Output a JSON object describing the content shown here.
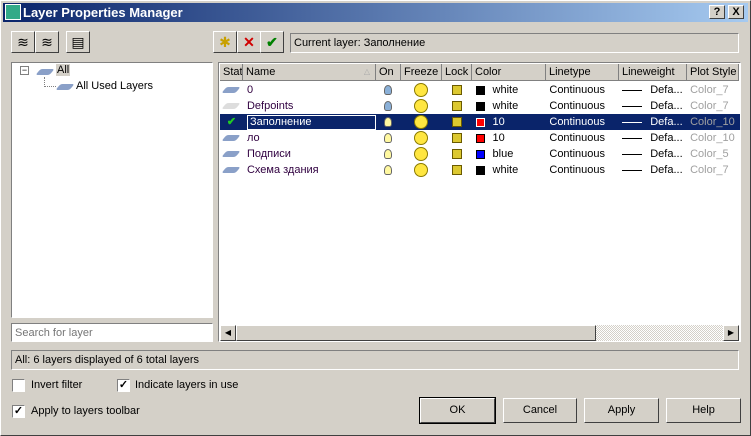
{
  "window": {
    "title": "Layer Properties Manager",
    "help": "?",
    "close": "X"
  },
  "toolbar": {
    "current_layer": "Current layer: Заполнение"
  },
  "tree": {
    "root": "All",
    "child": "All Used Layers",
    "expander": "−"
  },
  "search": {
    "placeholder": "Search for layer"
  },
  "columns": [
    "Stat",
    "Name",
    "On",
    "Freeze",
    "Lock",
    "Color",
    "Linetype",
    "Lineweight",
    "Plot Style"
  ],
  "layers": [
    {
      "name": "0",
      "color_name": "white",
      "color_hex": "#000000",
      "on": true,
      "linetype": "Continuous",
      "lineweight": "Defa...",
      "plot_style": "Color_7"
    },
    {
      "name": "Defpoints",
      "color_name": "white",
      "color_hex": "#000000",
      "on": true,
      "linetype": "Continuous",
      "lineweight": "Defa...",
      "plot_style": "Color_7"
    },
    {
      "name": "Заполнение",
      "color_name": "10",
      "color_hex": "#ff0000",
      "on": true,
      "current": true,
      "linetype": "Continuous",
      "lineweight": "Defa...",
      "plot_style": "Color_10"
    },
    {
      "name": "ло",
      "color_name": "10",
      "color_hex": "#ff0000",
      "on": true,
      "linetype": "Continuous",
      "lineweight": "Defa...",
      "plot_style": "Color_10"
    },
    {
      "name": "Подписи",
      "color_name": "blue",
      "color_hex": "#0000ff",
      "on": true,
      "linetype": "Continuous",
      "lineweight": "Defa...",
      "plot_style": "Color_5"
    },
    {
      "name": "Схема здания",
      "color_name": "white",
      "color_hex": "#000000",
      "on": true,
      "linetype": "Continuous",
      "lineweight": "Defa...",
      "plot_style": "Color_7"
    }
  ],
  "status": "All: 6 layers displayed of 6 total layers",
  "options": {
    "invert_filter": "Invert filter",
    "invert_checked": false,
    "indicate_in_use": "Indicate layers in use",
    "indicate_checked": true,
    "apply_toolbar": "Apply to layers toolbar",
    "apply_toolbar_checked": true
  },
  "buttons": {
    "ok": "OK",
    "cancel": "Cancel",
    "apply": "Apply",
    "help": "Help"
  }
}
